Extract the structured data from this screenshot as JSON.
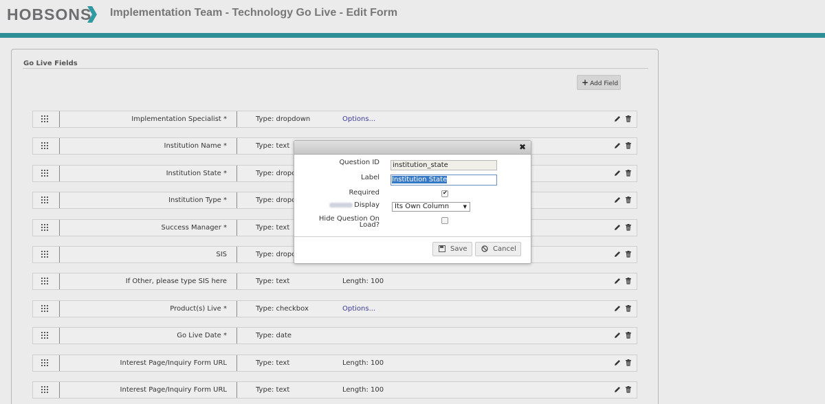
{
  "header": {
    "logo": "HOBSONS",
    "title": "Implementation Team - Technology Go Live - Edit Form",
    "accent_color": "#2f8f97"
  },
  "panel": {
    "title": "Go Live Fields",
    "add_field_label": "Add Field"
  },
  "fields": [
    {
      "label": "Implementation Specialist *",
      "type": "Type: dropdown",
      "extra": "Options..."
    },
    {
      "label": "Institution Name *",
      "type": "Type: text",
      "extra": ""
    },
    {
      "label": "Institution State *",
      "type": "Type: dropdo",
      "extra": ""
    },
    {
      "label": "Institution Type *",
      "type": "Type: dropdo",
      "extra": ""
    },
    {
      "label": "Success Manager *",
      "type": "Type: text",
      "extra": ""
    },
    {
      "label": "SIS",
      "type": "Type: dropdo",
      "extra": ""
    },
    {
      "label": "If Other, please type SIS here",
      "type": "Type: text",
      "extra": "Length: 100"
    },
    {
      "label": "Product(s) Live *",
      "type": "Type: checkbox",
      "extra": "Options..."
    },
    {
      "label": "Go Live Date *",
      "type": "Type: date",
      "extra": ""
    },
    {
      "label": "Interest Page/Inquiry Form URL",
      "type": "Type: text",
      "extra": "Length: 100"
    },
    {
      "label": "Interest Page/Inquiry Form URL",
      "type": "Type: text",
      "extra": "Length: 100"
    }
  ],
  "modal": {
    "question_id_label": "Question ID",
    "question_id_value": "institution_state",
    "label_label": "Label",
    "label_value": "Institution State",
    "required_label": "Required",
    "required_checked": true,
    "display_label": "Display",
    "display_value": "Its Own Column",
    "hide_label": "Hide Question On Load?",
    "hide_checked": false,
    "save_label": "Save",
    "cancel_label": "Cancel"
  }
}
